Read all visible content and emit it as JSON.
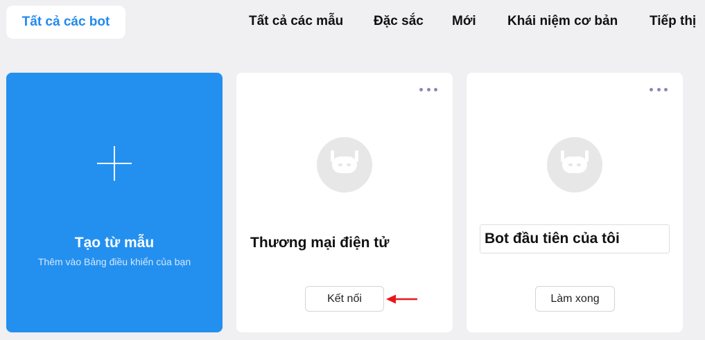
{
  "tabs": {
    "active_label": "Tất cả các bot",
    "items": [
      "Tất cả các mẫu",
      "Đặc sắc",
      "Mới",
      "Khái niệm cơ bản",
      "Tiếp thị"
    ]
  },
  "create_card": {
    "title": "Tạo từ mẫu",
    "subtitle": "Thêm vào Bảng điều khiển của bạn"
  },
  "cards": [
    {
      "title": "Thương mại điện tử",
      "button_label": "Kết nối"
    },
    {
      "title": "Bot đầu tiên của tôi",
      "button_label": "Làm xong"
    }
  ],
  "colors": {
    "accent": "#2390f0",
    "active_tab_text": "#2389ee",
    "background": "#f0eff1",
    "annotation_arrow": "#e8161b",
    "more_dots": "#8e86b6"
  },
  "icons": {
    "create": "plus-icon",
    "menu": "more-horizontal-icon",
    "avatar": "robot-icon",
    "annotation": "red-arrow-icon"
  }
}
